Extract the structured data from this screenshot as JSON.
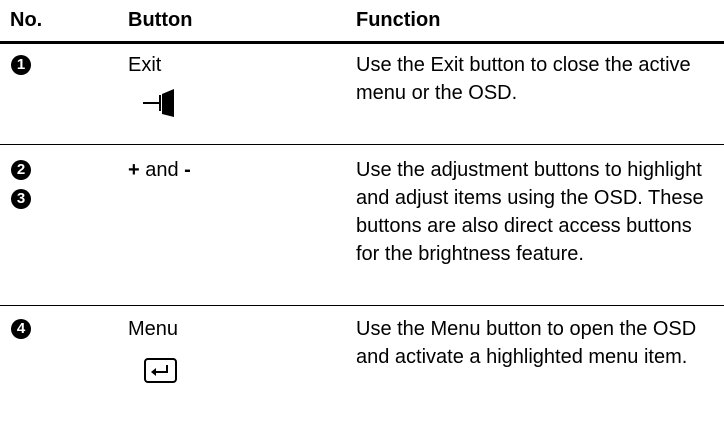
{
  "header": {
    "no": "No.",
    "button": "Button",
    "function": "Function"
  },
  "rows": [
    {
      "numbers": [
        "1"
      ],
      "button": "Exit",
      "icon": "exit-door-icon",
      "function": "Use the Exit button to close the active menu or the OSD."
    },
    {
      "numbers": [
        "2",
        "3"
      ],
      "button_plus": "+",
      "button_and": " and ",
      "button_minus": "-",
      "function": "Use the adjustment buttons to highlight and adjust items using the OSD. These buttons are also direct access buttons for the brightness feature."
    },
    {
      "numbers": [
        "4"
      ],
      "button": "Menu",
      "icon": "enter-key-icon",
      "function": "Use the Menu button to open the OSD and activate a highlighted menu item."
    }
  ]
}
